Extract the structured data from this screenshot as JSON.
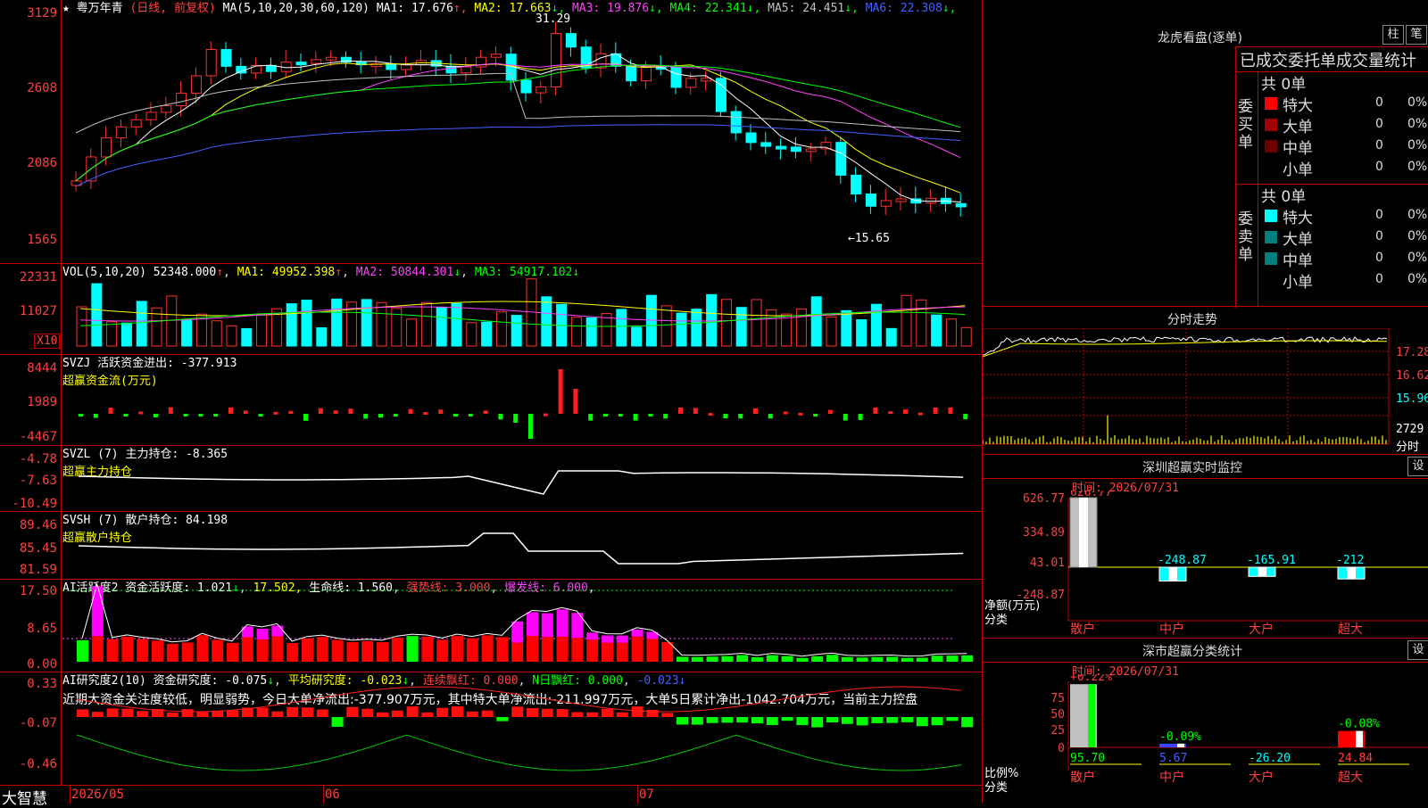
{
  "stock": {
    "name": "★ 粤万年青",
    "mode": "(日线, 前复权)",
    "ma_header": "MA(5,10,20,30,60,120)",
    "ma_values": [
      {
        "label": "MA1:",
        "value": "17.676",
        "arrow": "↑",
        "color": "#ffffff"
      },
      {
        "label": "MA2:",
        "value": "17.663",
        "arrow": "↓",
        "color": "#ffff00"
      },
      {
        "label": "MA3:",
        "value": "19.876",
        "arrow": "↓",
        "color": "#ff40ff"
      },
      {
        "label": "MA4:",
        "value": "22.341",
        "arrow": "↓",
        "color": "#00ff00"
      },
      {
        "label": "MA5:",
        "value": "24.451",
        "arrow": "↓",
        "color": "#c0c0c0"
      },
      {
        "label": "MA6:",
        "value": "22.308",
        "arrow": "↓",
        "color": "#4060ff"
      }
    ],
    "high_mark": "31.29",
    "low_mark": "←15.65"
  },
  "panes": {
    "price": {
      "ticks": [
        "3129",
        "2608",
        "2086",
        "1565"
      ]
    },
    "vol": {
      "header": "VOL(5,10,20)",
      "value": "52348.000",
      "ma1": "MA1: 49952.398",
      "ma2": "MA2: 50844.301",
      "ma3": "MA3: 54917.102",
      "ticks": [
        "22331",
        "11027"
      ],
      "unit": "X10"
    },
    "svzj": {
      "header": "SVZJ  活跃资金进出: -377.913",
      "subtitle": "超赢资金流(万元)",
      "ticks": [
        "8444",
        "1989",
        "-4467"
      ]
    },
    "svzl": {
      "header": "SVZL (7) 主力持仓: -8.365",
      "subtitle": "超赢主力持仓",
      "ticks": [
        "-4.78",
        "-7.63",
        "-10.49"
      ]
    },
    "svsh": {
      "header": "SVSH (7) 散户持仓: 84.198",
      "subtitle": "超赢散户持仓",
      "ticks": [
        "89.46",
        "85.45",
        "81.59"
      ]
    },
    "active": {
      "header": "AI活跃度2 资金活跃度: 1.021",
      "v2": "17.502",
      "life": "生命线: 1.560",
      "strong": "强势线: 3.000",
      "burst": "爆发线: 6.000",
      "ticks": [
        "17.50",
        "8.65",
        "0.00"
      ]
    },
    "research": {
      "header": "AI研究度2(10) 资金研究度: -0.075",
      "avg": "平均研究度: -0.023",
      "red": "连续飘红: 0.000",
      "nred": "N日飘红: 0.000",
      "last": "-0.023",
      "note": "近期大资金关注度较低，明显弱势，今日大单净流出:-377.907万元，其中特大单净流出:-211.997万元，大单5日累计净出-1042.704万元，当前主力控盘",
      "ticks": [
        "0.33",
        "-0.07",
        "-0.46"
      ]
    }
  },
  "bottom": {
    "brand": "大智慧",
    "dates": [
      "2026/05",
      "06",
      "07"
    ]
  },
  "dragon": {
    "title": "龙虎看盘(逐单)",
    "btn1": "柱",
    "btn2": "笔",
    "header": "已成交委托单成交量统计",
    "buy_label": "委买单",
    "sell_label": "委卖单",
    "buy_total": "共 0单",
    "sell_total": "共 0单",
    "rows": [
      {
        "name": "特大",
        "v": "0",
        "p": "0%"
      },
      {
        "name": "大单",
        "v": "0",
        "p": "0%"
      },
      {
        "name": "中单",
        "v": "0",
        "p": "0%"
      },
      {
        "name": "小单",
        "v": "0",
        "p": "0%"
      }
    ],
    "buy_colors": [
      "#ff0000",
      "#a00000",
      "#700000",
      "#000000"
    ],
    "sell_colors": [
      "#00ffff",
      "#008080",
      "#008080",
      "#000000"
    ]
  },
  "intraday": {
    "title": "分时走势",
    "ticks": [
      "17.28",
      "16.62",
      "15.96",
      "2729",
      "分时"
    ]
  },
  "sz_monitor": {
    "title": "深圳超赢实时监控",
    "set": "设",
    "time": "时间: 2026/07/31",
    "ticks": [
      "626.77",
      "334.89",
      "43.01",
      "-248.87"
    ],
    "unit": "净额(万元)",
    "cat_label": "分类",
    "bars": [
      {
        "cat": "散户",
        "value": "626.77",
        "num": 626.77
      },
      {
        "cat": "中户",
        "value": "-248.87",
        "num": -248.87
      },
      {
        "cat": "大户",
        "value": "-165.91",
        "num": -165.91
      },
      {
        "cat": "超大",
        "value": "-212",
        "num": -212
      }
    ]
  },
  "sz_class": {
    "title": "深市超赢分类统计",
    "set": "设",
    "time": "时间: 2026/07/31",
    "ticks": [
      "75",
      "50",
      "25",
      "0"
    ],
    "unit": "比例%",
    "cat_label": "分类",
    "top_labels": [
      "+0.22%",
      "-0.09%",
      "",
      "-0.08%"
    ],
    "bars": [
      {
        "cat": "散户",
        "value": "95.70",
        "num": 95.7
      },
      {
        "cat": "中户",
        "value": "5.67",
        "num": 5.67
      },
      {
        "cat": "大户",
        "value": "-26.20",
        "num": -26.2
      },
      {
        "cat": "超大",
        "value": "24.84",
        "num": 24.84
      }
    ]
  }
}
